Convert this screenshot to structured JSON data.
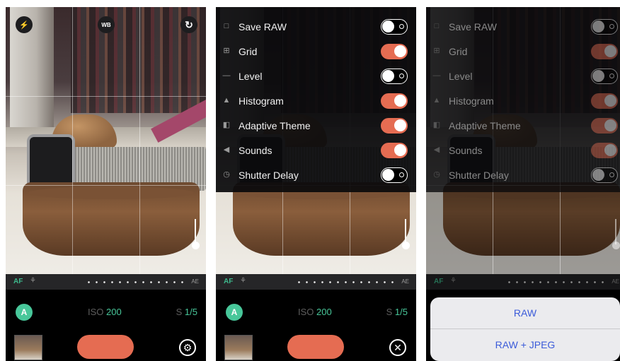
{
  "top_icons": {
    "flash": "⚡",
    "white_balance": "WB",
    "flip": "↻"
  },
  "settings": [
    {
      "label": "Save RAW",
      "icon": "raw-icon",
      "glyph": "□",
      "on": false
    },
    {
      "label": "Grid",
      "icon": "grid-icon",
      "glyph": "⊞",
      "on": true
    },
    {
      "label": "Level",
      "icon": "level-icon",
      "glyph": "—",
      "on": false
    },
    {
      "label": "Histogram",
      "icon": "histogram-icon",
      "glyph": "▲",
      "on": true
    },
    {
      "label": "Adaptive Theme",
      "icon": "theme-icon",
      "glyph": "◧",
      "on": true
    },
    {
      "label": "Sounds",
      "icon": "speaker-icon",
      "glyph": "◀",
      "on": true
    },
    {
      "label": "Shutter Delay",
      "icon": "timer-icon",
      "glyph": "◷",
      "on": false
    }
  ],
  "af_label": "AF",
  "af_end": "AE",
  "mode_badge": "A",
  "iso": {
    "label": "ISO",
    "value": "200"
  },
  "shutter_speed": {
    "prefix": "S",
    "value": "1/5"
  },
  "close_glyph": "✕",
  "settings_glyph": "⚙",
  "raw_options": [
    "RAW",
    "RAW + JPEG"
  ],
  "colors": {
    "accent_toggle": "#e56c52",
    "accent_green": "#48c79a",
    "sheet_text": "#3b5bd9"
  }
}
